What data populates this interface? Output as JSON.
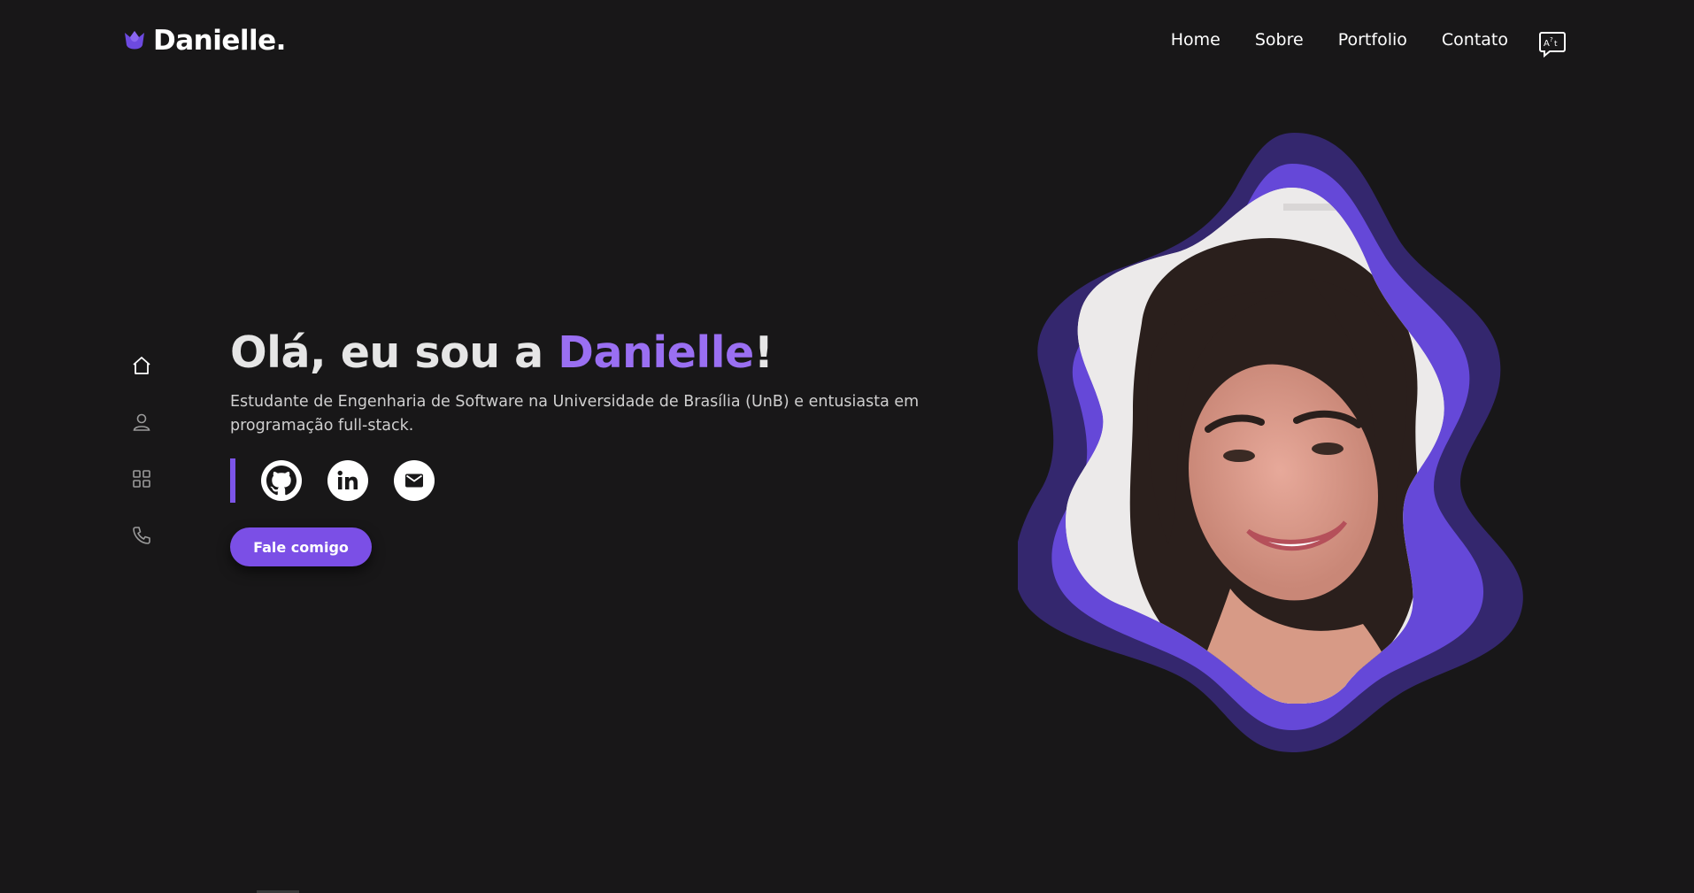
{
  "header": {
    "logo_text": "Danielle.",
    "nav": [
      {
        "label": "Home"
      },
      {
        "label": "Sobre"
      },
      {
        "label": "Portfolio"
      },
      {
        "label": "Contato"
      }
    ],
    "translate_icon": "translate-icon"
  },
  "side_nav": [
    {
      "icon": "home-icon"
    },
    {
      "icon": "user-icon"
    },
    {
      "icon": "grid-icon"
    },
    {
      "icon": "phone-icon"
    }
  ],
  "hero": {
    "greeting": "Olá, eu sou a ",
    "name": "Danielle",
    "exclaim": "!",
    "description": "Estudante de Engenharia de Software na Universidade de Brasília (UnB) e entusiasta em programação full-stack.",
    "cta_label": "Fale comigo"
  },
  "socials": [
    {
      "icon": "github-icon"
    },
    {
      "icon": "linkedin-icon"
    },
    {
      "icon": "mail-icon"
    }
  ],
  "colors": {
    "background": "#181718",
    "accent": "#7b4fe6",
    "accent_text": "#9a6ff2",
    "blob_outer": "#3a2a7a",
    "blob_inner": "#6a4ad8"
  }
}
